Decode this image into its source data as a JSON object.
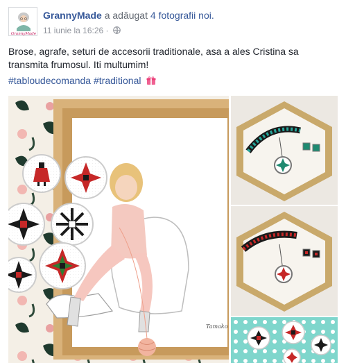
{
  "post": {
    "author": "GrannyMade",
    "action": "a adăugat",
    "photos_link": "4 fotografii noi.",
    "timestamp": "11 iunie la 16:26",
    "separator": "·",
    "text": "Brose, agrafe, seturi de accesorii traditionale, asa a ales Cristina sa transmita frumosul. Iti multumim!",
    "hashtags": [
      "#tabloudecomanda",
      "#traditional"
    ],
    "avatar_text": "GrannyMade",
    "illustration_signature": "Tamako"
  },
  "icons": {
    "privacy": "globe-icon",
    "emoji": "gift-emoji-icon"
  },
  "colors": {
    "link": "#365899",
    "meta": "#90949c",
    "text": "#1d2129"
  }
}
